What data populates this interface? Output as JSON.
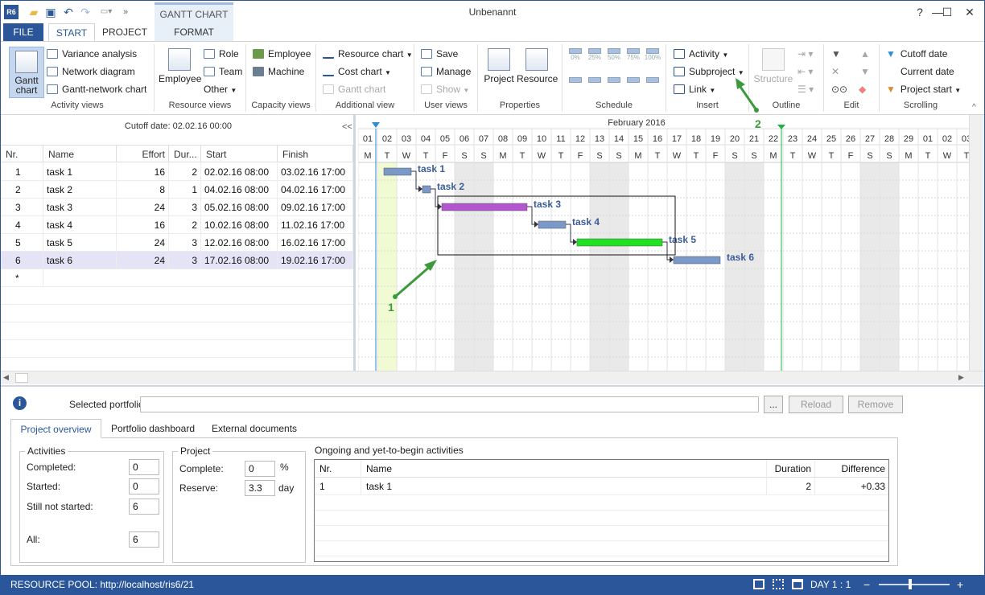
{
  "window": {
    "title": "Unbenannt",
    "minimize": "—",
    "maximize": "☐",
    "close": "✕"
  },
  "quick_access": {
    "app_icon": "R6",
    "undo": "↶",
    "redo": "↷",
    "more": "»"
  },
  "tabs": [
    {
      "label": "FILE"
    },
    {
      "label": "START"
    },
    {
      "label": "PROJECT"
    },
    {
      "label": "FORMAT"
    }
  ],
  "context_tab_header": "GANTT CHART",
  "ribbon": {
    "activity_views": {
      "label": "Activity views",
      "gantt_chart": "Gantt chart",
      "variance_analysis": "Variance analysis",
      "network_diagram": "Network diagram",
      "gantt_network_chart": "Gantt-network chart"
    },
    "resource_views": {
      "label": "Resource views",
      "employee": "Employee",
      "role": "Role",
      "team": "Team",
      "other": "Other"
    },
    "capacity_views": {
      "label": "Capacity views",
      "employee": "Employee",
      "machine": "Machine"
    },
    "additional_view": {
      "label": "Additional view",
      "resource_chart": "Resource chart",
      "cost_chart": "Cost chart",
      "gantt_chart": "Gantt chart"
    },
    "user_views": {
      "label": "User views",
      "save": "Save",
      "manage": "Manage",
      "show": "Show"
    },
    "properties": {
      "label": "Properties",
      "project": "Project",
      "resource": "Resource"
    },
    "schedule": {
      "label": "Schedule",
      "percents": [
        "0%",
        "25%",
        "50%",
        "75%",
        "100%"
      ]
    },
    "insert": {
      "label": "Insert",
      "activity": "Activity",
      "subproject": "Subproject",
      "link": "Link"
    },
    "outline": {
      "label": "Outline",
      "structure": "Structure"
    },
    "edit": {
      "label": "Edit"
    },
    "scrolling": {
      "label": "Scrolling",
      "cutoff_date": "Cutoff date",
      "current_date": "Current date",
      "project_start": "Project start"
    }
  },
  "grid": {
    "cutoff": "Cutoff date: 02.02.16 00:00",
    "collapse": "<<",
    "columns": {
      "nr": "Nr.",
      "name": "Name",
      "effort": "Effort",
      "duration": "Dur...",
      "start": "Start",
      "finish": "Finish"
    },
    "rows": [
      {
        "nr": "1",
        "name": "task 1",
        "effort": "16",
        "duration": "2",
        "start": "02.02.16 08:00",
        "finish": "03.02.16 17:00"
      },
      {
        "nr": "2",
        "name": "task 2",
        "effort": "8",
        "duration": "1",
        "start": "04.02.16 08:00",
        "finish": "04.02.16 17:00"
      },
      {
        "nr": "3",
        "name": "task 3",
        "effort": "24",
        "duration": "3",
        "start": "05.02.16 08:00",
        "finish": "09.02.16 17:00"
      },
      {
        "nr": "4",
        "name": "task 4",
        "effort": "16",
        "duration": "2",
        "start": "10.02.16 08:00",
        "finish": "11.02.16 17:00"
      },
      {
        "nr": "5",
        "name": "task 5",
        "effort": "24",
        "duration": "3",
        "start": "12.02.16 08:00",
        "finish": "16.02.16 17:00"
      },
      {
        "nr": "6",
        "name": "task 6",
        "effort": "24",
        "duration": "3",
        "start": "17.02.16 08:00",
        "finish": "19.02.16 17:00"
      }
    ],
    "new_row": "*"
  },
  "gantt": {
    "month": "February 2016",
    "days": [
      "01",
      "02",
      "03",
      "04",
      "05",
      "06",
      "07",
      "08",
      "09",
      "10",
      "11",
      "12",
      "13",
      "14",
      "15",
      "16",
      "17",
      "18",
      "19",
      "20",
      "21",
      "22",
      "23",
      "24",
      "25",
      "26",
      "27",
      "28",
      "29",
      "01",
      "02",
      "03"
    ],
    "weekdays": [
      "M",
      "T",
      "W",
      "T",
      "F",
      "S",
      "S",
      "M",
      "T",
      "W",
      "T",
      "F",
      "S",
      "S",
      "M",
      "T",
      "W",
      "T",
      "F",
      "S",
      "S",
      "M",
      "T",
      "W",
      "T",
      "F",
      "S",
      "S",
      "M",
      "T",
      "W",
      "T"
    ],
    "weekend_indexes": [
      5,
      6,
      12,
      13,
      19,
      20,
      26,
      27
    ],
    "bar_color": "#7a98c8",
    "task_labels": [
      "task 1",
      "task 2",
      "task 3",
      "task 4",
      "task 5",
      "task 6"
    ],
    "annotations": {
      "one": "1",
      "two": "2"
    }
  },
  "bottom": {
    "selected_portfolio_label": "Selected portfolio:",
    "selected_portfolio_value": "",
    "browse": "...",
    "reload": "Reload",
    "remove": "Remove",
    "tabs": [
      "Project overview",
      "Portfolio dashboard",
      "External documents"
    ],
    "activities": {
      "title": "Activities",
      "completed_label": "Completed:",
      "completed": "0",
      "started_label": "Started:",
      "started": "0",
      "not_started_label": "Still not started:",
      "not_started": "6",
      "all_label": "All:",
      "all": "6"
    },
    "project": {
      "title": "Project",
      "complete_label": "Complete:",
      "complete": "0",
      "complete_unit": "%",
      "reserve_label": "Reserve:",
      "reserve": "3.3",
      "reserve_unit": "day"
    },
    "ongoing": {
      "title": "Ongoing and yet-to-begin activities",
      "columns": {
        "nr": "Nr.",
        "name": "Name",
        "duration": "Duration",
        "difference": "Difference"
      },
      "rows": [
        {
          "nr": "1",
          "name": "task 1",
          "duration": "2",
          "difference": "+0.33"
        }
      ]
    }
  },
  "status": {
    "resource_pool": "RESOURCE POOL: http://localhost/ris6/21",
    "zoom": "DAY 1 : 1",
    "minus": "−",
    "plus": "+"
  }
}
